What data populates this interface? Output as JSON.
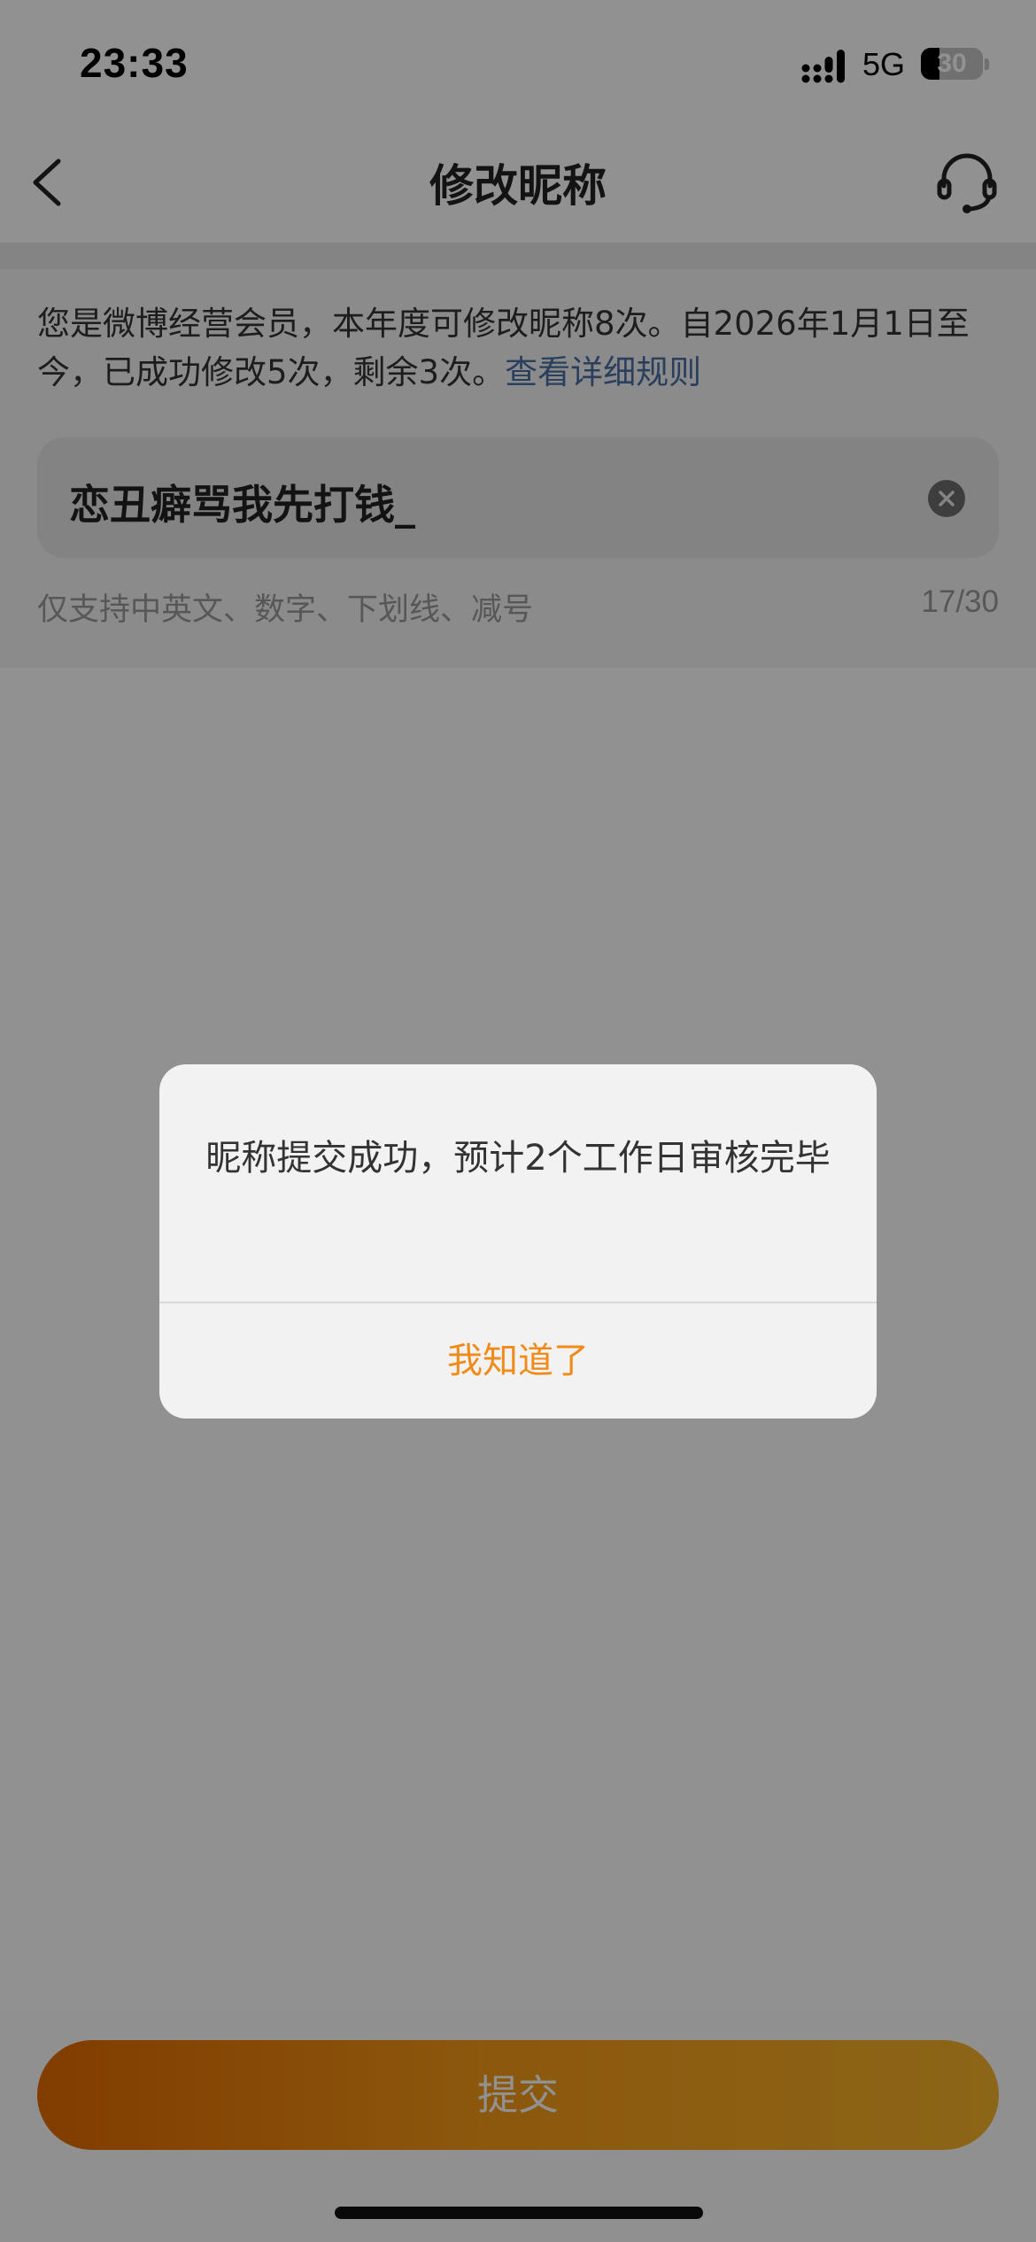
{
  "status_bar": {
    "time": "23:33",
    "network": "5G",
    "battery": "30",
    "battery_level": 0.3
  },
  "nav": {
    "title": "修改昵称"
  },
  "notice": {
    "text": "您是微博经营会员，本年度可修改昵称8次。自2026年1月1日至今，已成功修改5次，剩余3次。",
    "link": "查看详细规则"
  },
  "nickname": {
    "value": "恋丑癖骂我先打钱_",
    "hint": "仅支持中英文、数字、下划线、减号",
    "counter": "17/30"
  },
  "submit": {
    "label": "提交"
  },
  "dialog": {
    "message": "昵称提交成功，预计2个工作日审核完毕",
    "button": "我知道了"
  },
  "colors": {
    "accent": "#f08a18",
    "link": "#4a6fa5",
    "button_gradient_start": "#e46a00",
    "button_gradient_end": "#f7b32b"
  }
}
